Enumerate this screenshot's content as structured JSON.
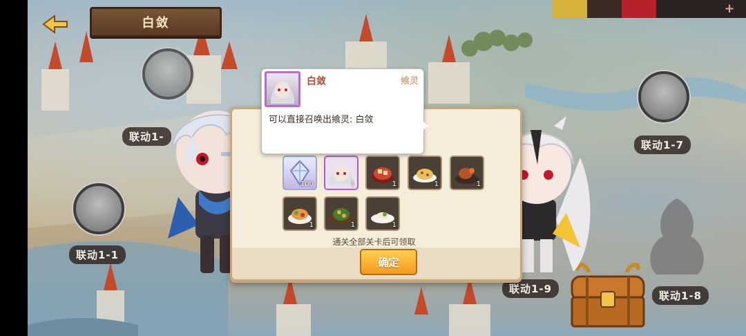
{
  "header": {
    "title": "白敛"
  },
  "top_bar": {
    "colors": [
      "#d7b23a",
      "#3a2b25",
      "#b8202a",
      "#2a2322"
    ],
    "plus_label": "+"
  },
  "map_nodes": [
    {
      "label": "联动1-1"
    },
    {
      "label": "联动1-"
    },
    {
      "label": "联动1-7"
    },
    {
      "label": "联动1-8"
    },
    {
      "label": "联动1-9"
    }
  ],
  "tooltip": {
    "name": "白敛",
    "type": "飨灵",
    "description": "可以直接召唤出飨灵: 白敛"
  },
  "rewards": [
    {
      "icon": "crystal-icon",
      "count": "100"
    },
    {
      "icon": "portrait-icon",
      "count": "1"
    },
    {
      "icon": "dish-icon",
      "count": "1"
    },
    {
      "icon": "dish-icon",
      "count": "1"
    },
    {
      "icon": "dish-icon",
      "count": "1"
    },
    {
      "icon": "dish-icon",
      "count": "1"
    },
    {
      "icon": "dish-icon",
      "count": "1"
    },
    {
      "icon": "dish-icon",
      "count": "1"
    }
  ],
  "dialog": {
    "note": "通关全部关卡后可领取",
    "confirm_label": "确定"
  }
}
